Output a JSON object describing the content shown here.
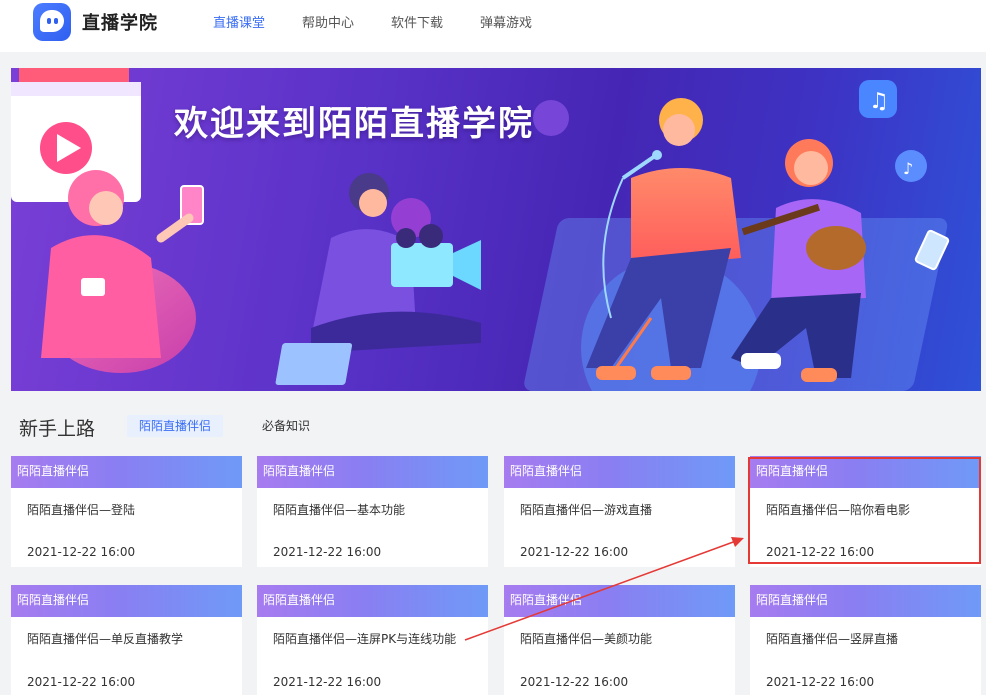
{
  "header": {
    "logo_text": "直播学院",
    "nav": [
      {
        "label": "直播课堂",
        "active": true
      },
      {
        "label": "帮助中心",
        "active": false
      },
      {
        "label": "软件下载",
        "active": false
      },
      {
        "label": "弹幕游戏",
        "active": false
      }
    ]
  },
  "banner": {
    "title": "欢迎来到陌陌直播学院"
  },
  "section": {
    "title": "新手上路",
    "tabs": [
      {
        "label": "陌陌直播伴侣",
        "active": true
      },
      {
        "label": "必备知识",
        "active": false
      }
    ]
  },
  "cards": [
    {
      "tag": "陌陌直播伴侣",
      "title": "陌陌直播伴侣—登陆",
      "date": "2021-12-22 16:00"
    },
    {
      "tag": "陌陌直播伴侣",
      "title": "陌陌直播伴侣—基本功能",
      "date": "2021-12-22 16:00"
    },
    {
      "tag": "陌陌直播伴侣",
      "title": "陌陌直播伴侣—游戏直播",
      "date": "2021-12-22 16:00"
    },
    {
      "tag": "陌陌直播伴侣",
      "title": "陌陌直播伴侣—陪你看电影",
      "date": "2021-12-22 16:00"
    },
    {
      "tag": "陌陌直播伴侣",
      "title": "陌陌直播伴侣—单反直播教学",
      "date": "2021-12-22 16:00"
    },
    {
      "tag": "陌陌直播伴侣",
      "title": "陌陌直播伴侣—连屏PK与连线功能",
      "date": "2021-12-22 16:00"
    },
    {
      "tag": "陌陌直播伴侣",
      "title": "陌陌直播伴侣—美颜功能",
      "date": "2021-12-22 16:00"
    },
    {
      "tag": "陌陌直播伴侣",
      "title": "陌陌直播伴侣—竖屏直播",
      "date": "2021-12-22 16:00"
    }
  ],
  "colors": {
    "accent": "#3a6ef5",
    "highlight": "#e53935"
  }
}
